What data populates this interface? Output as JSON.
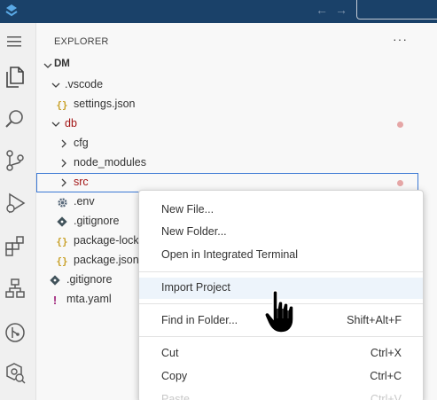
{
  "titlebar": {
    "logo_icon": "app-logo-icon",
    "back_icon": "arrow-left-icon",
    "forward_icon": "arrow-right-icon",
    "back_glyph": "←",
    "forward_glyph": "→",
    "bg_color": "#1a4169"
  },
  "activitybar": {
    "items": [
      {
        "icon": "menu-icon"
      },
      {
        "icon": "files-icon"
      },
      {
        "icon": "search-icon"
      },
      {
        "icon": "source-control-icon"
      },
      {
        "icon": "run-debug-icon"
      },
      {
        "icon": "extensions-icon"
      },
      {
        "icon": "hierarchy-icon"
      },
      {
        "icon": "git-graph-icon"
      },
      {
        "icon": "settings-search-icon"
      }
    ]
  },
  "explorer": {
    "title": "EXPLORER",
    "more": "···",
    "root": "DM",
    "items": [
      {
        "label": ".vscode",
        "type": "folder",
        "expanded": true,
        "level": 1
      },
      {
        "label": "settings.json",
        "type": "json",
        "level": 2
      },
      {
        "label": "db",
        "type": "folder",
        "expanded": true,
        "level": 1,
        "modified": true,
        "color": "#a31515"
      },
      {
        "label": "cfg",
        "type": "folder",
        "expanded": false,
        "level": 2
      },
      {
        "label": "node_modules",
        "type": "folder",
        "expanded": false,
        "level": 2
      },
      {
        "label": "src",
        "type": "folder",
        "expanded": false,
        "level": 2,
        "modified": true,
        "selected": true,
        "color": "#a31515"
      },
      {
        "label": ".env",
        "type": "gear",
        "level": 2
      },
      {
        "label": ".gitignore",
        "type": "git",
        "level": 2
      },
      {
        "label": "package-lock",
        "type": "json",
        "level": 2
      },
      {
        "label": "package.json",
        "type": "json",
        "level": 2
      },
      {
        "label": ".gitignore",
        "type": "git",
        "level": 1
      },
      {
        "label": "mta.yaml",
        "type": "yaml",
        "level": 1
      }
    ],
    "modified_color": "#e5a6a6"
  },
  "context_menu": {
    "groups": [
      [
        {
          "label": "New File...",
          "shortcut": ""
        },
        {
          "label": "New Folder...",
          "shortcut": ""
        },
        {
          "label": "Open in Integrated Terminal",
          "shortcut": ""
        }
      ],
      [
        {
          "label": "Import Project",
          "shortcut": "",
          "hover": true
        }
      ],
      [
        {
          "label": "Find in Folder...",
          "shortcut": "Shift+Alt+F"
        }
      ],
      [
        {
          "label": "Cut",
          "shortcut": "Ctrl+X"
        },
        {
          "label": "Copy",
          "shortcut": "Ctrl+C"
        },
        {
          "label": "Paste",
          "shortcut": "Ctrl+V",
          "faded": true
        }
      ]
    ]
  }
}
